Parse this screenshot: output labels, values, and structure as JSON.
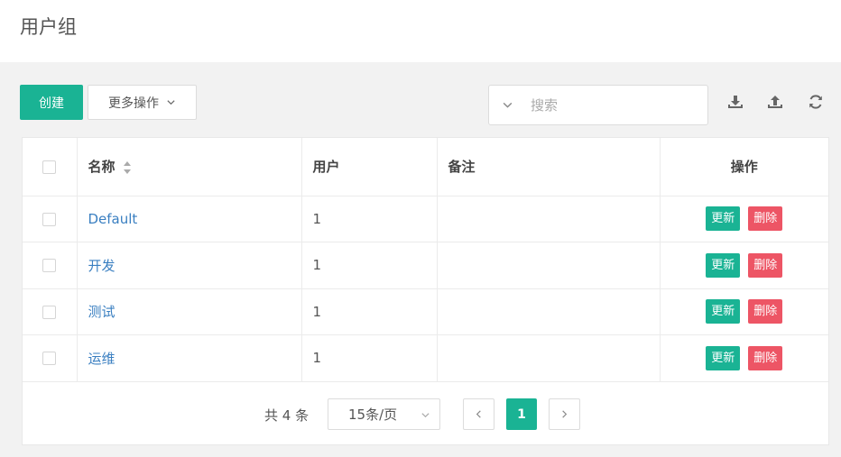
{
  "page": {
    "title": "用户组"
  },
  "toolbar": {
    "create_label": "创建",
    "more_label": "更多操作",
    "search_placeholder": "搜索",
    "icons": [
      "download-icon",
      "upload-icon",
      "refresh-icon"
    ]
  },
  "table": {
    "columns": [
      "名称",
      "用户",
      "备注",
      "操作"
    ],
    "rows": [
      {
        "name": "Default",
        "users": "1",
        "note": ""
      },
      {
        "name": "开发",
        "users": "1",
        "note": ""
      },
      {
        "name": "测试",
        "users": "1",
        "note": ""
      },
      {
        "name": "运维",
        "users": "1",
        "note": ""
      }
    ],
    "update_label": "更新",
    "delete_label": "删除"
  },
  "pagination": {
    "total_text": "共 4 条",
    "page_size": "15条/页",
    "current_page": "1"
  },
  "colors": {
    "primary": "#1ab394",
    "danger": "#ed5565",
    "link": "#3a7fc1"
  }
}
